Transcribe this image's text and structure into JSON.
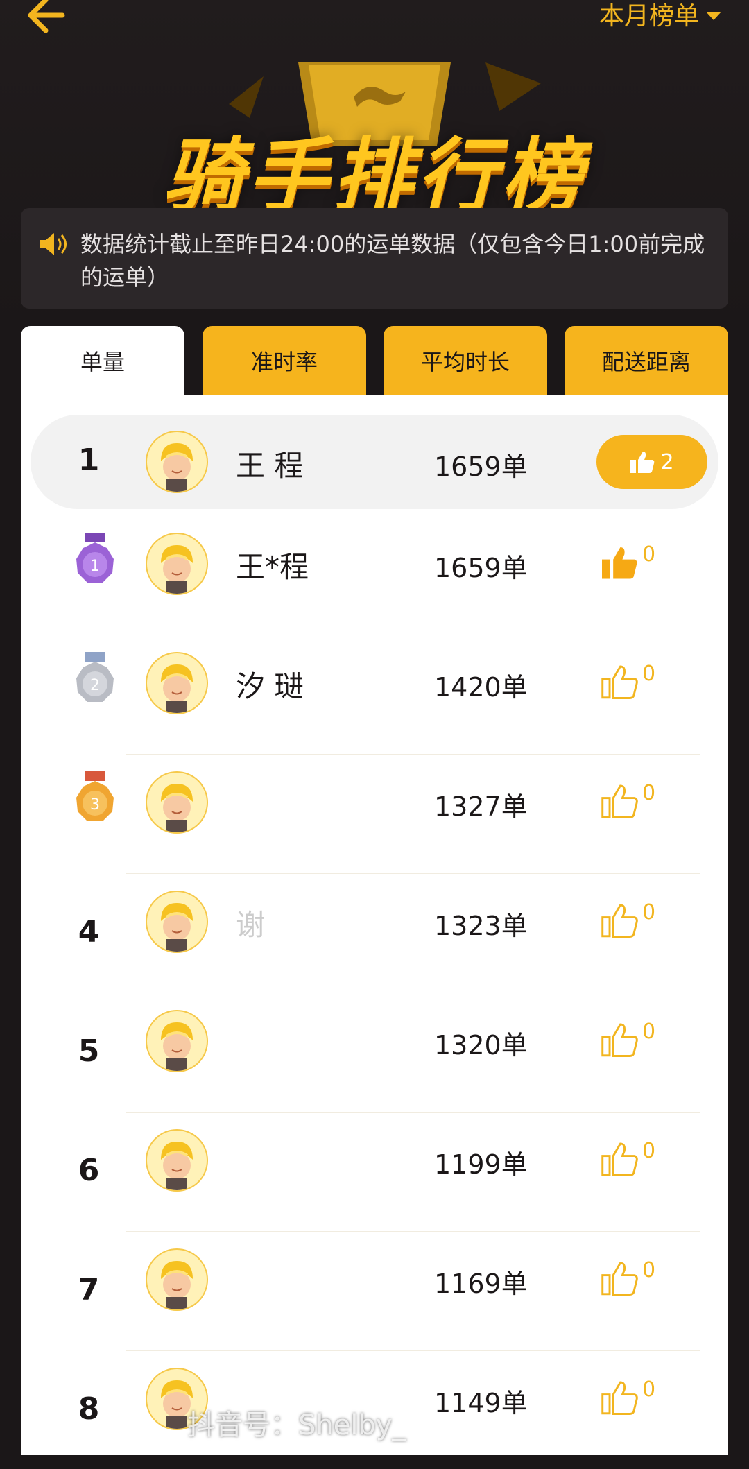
{
  "header": {
    "period_label": "本月榜单",
    "banner_title": "骑手排行榜"
  },
  "notice": {
    "text": "数据统计截止至昨日24:00的运单数据（仅包含今日1:00前完成的运单）"
  },
  "tabs": [
    {
      "label": "单量",
      "active": true
    },
    {
      "label": "准时率",
      "active": false
    },
    {
      "label": "平均时长",
      "active": false
    },
    {
      "label": "配送距离",
      "active": false
    }
  ],
  "my_row": {
    "rank": "1",
    "name": "王  程",
    "count": "1659单",
    "likes": "2"
  },
  "rows": [
    {
      "rank": "1",
      "medal": "gold-purple",
      "name": "王*程",
      "count": "1659单",
      "likes": "0",
      "liked": true
    },
    {
      "rank": "2",
      "medal": "silver",
      "name": "汐  琎",
      "count": "1420单",
      "likes": "0",
      "liked": false
    },
    {
      "rank": "3",
      "medal": "bronze",
      "name": "",
      "count": "1327单",
      "likes": "0",
      "liked": false
    },
    {
      "rank": "4",
      "medal": "",
      "name": "谢",
      "count": "1323单",
      "likes": "0",
      "liked": false
    },
    {
      "rank": "5",
      "medal": "",
      "name": "",
      "count": "1320单",
      "likes": "0",
      "liked": false
    },
    {
      "rank": "6",
      "medal": "",
      "name": "",
      "count": "1199单",
      "likes": "0",
      "liked": false
    },
    {
      "rank": "7",
      "medal": "",
      "name": "",
      "count": "1169单",
      "likes": "0",
      "liked": false
    },
    {
      "rank": "8",
      "medal": "",
      "name": "",
      "count": "1149单",
      "likes": "0",
      "liked": false
    }
  ],
  "watermark": "抖音号：Shelby_",
  "colors": {
    "accent": "#f6b41d",
    "background": "#1b1718",
    "medal_1": "#9b62d6",
    "medal_2": "#b9bcc4",
    "medal_3": "#f0a531"
  }
}
